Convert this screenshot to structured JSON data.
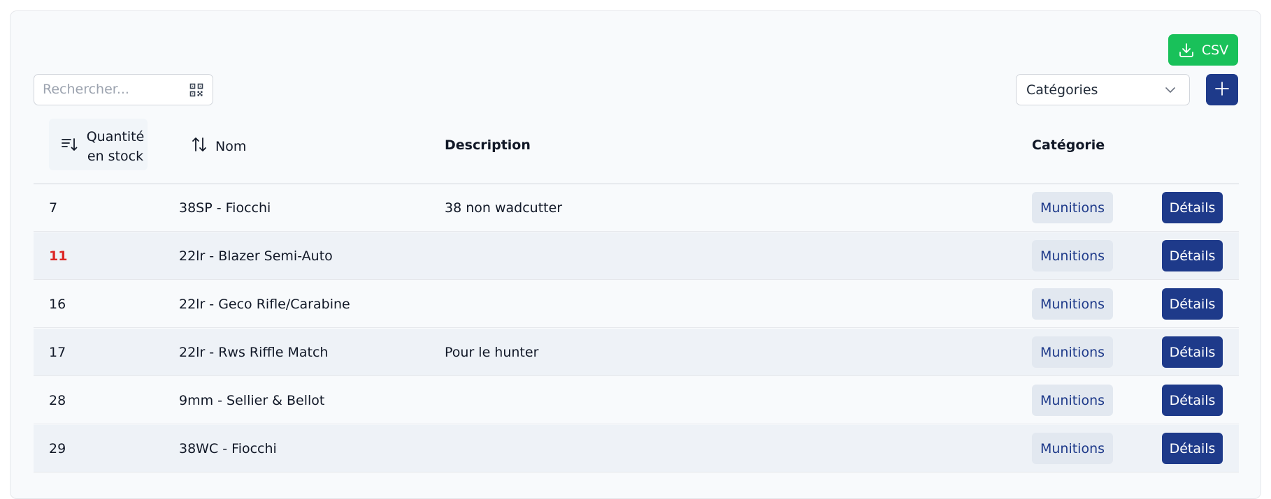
{
  "toolbar": {
    "csv_label": "CSV",
    "search_placeholder": "Rechercher...",
    "category_select": "Catégories",
    "add_icon": "plus-icon"
  },
  "table": {
    "headers": {
      "quantity_line1": "Quantité",
      "quantity_line2": "en stock",
      "name": "Nom",
      "description": "Description",
      "category": "Catégorie"
    },
    "rows": [
      {
        "quantity": "7",
        "name": "38SP - Fiocchi",
        "description": "38 non wadcutter",
        "category": "Munitions",
        "action": "Détails",
        "low_stock": false
      },
      {
        "quantity": "11",
        "name": "22lr - Blazer Semi-Auto",
        "description": "",
        "category": "Munitions",
        "action": "Détails",
        "low_stock": true
      },
      {
        "quantity": "16",
        "name": "22lr - Geco Rifle/Carabine",
        "description": "",
        "category": "Munitions",
        "action": "Détails",
        "low_stock": false
      },
      {
        "quantity": "17",
        "name": "22lr - Rws Riffle Match",
        "description": "Pour le hunter",
        "category": "Munitions",
        "action": "Détails",
        "low_stock": false
      },
      {
        "quantity": "28",
        "name": "9mm - Sellier & Bellot",
        "description": "",
        "category": "Munitions",
        "action": "Détails",
        "low_stock": false
      },
      {
        "quantity": "29",
        "name": "38WC - Fiocchi",
        "description": "",
        "category": "Munitions",
        "action": "Détails",
        "low_stock": false
      }
    ]
  },
  "colors": {
    "primary": "#1e3a8a",
    "success": "#19c15a",
    "low_stock": "#dc2626",
    "badge_bg": "#e2e8f0"
  }
}
